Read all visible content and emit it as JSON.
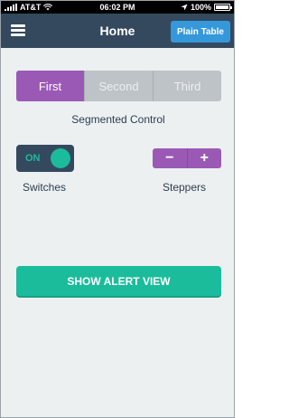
{
  "status_bar": {
    "carrier": "AT&T",
    "time": "06:02 PM",
    "battery": "100%",
    "battery_level": 1.0
  },
  "nav": {
    "title": "Home",
    "menu_icon": "hamburger-menu-icon",
    "right_button": "Plain Table"
  },
  "segmented": {
    "items": [
      "First",
      "Second",
      "Third"
    ],
    "selected": "First",
    "caption": "Segmented Control"
  },
  "switch": {
    "state_label": "ON",
    "caption": "Switches"
  },
  "stepper": {
    "minus": "−",
    "plus": "+",
    "caption": "Steppers"
  },
  "alert_button": {
    "label": "SHOW ALERT VIEW"
  },
  "colors": {
    "navbar": "#34495e",
    "accent_blue": "#3498db",
    "accent_purple": "#9b59b6",
    "accent_turquoise": "#1abc9c",
    "background": "#ecf0f1",
    "segment_inactive": "#bdc3c7"
  }
}
